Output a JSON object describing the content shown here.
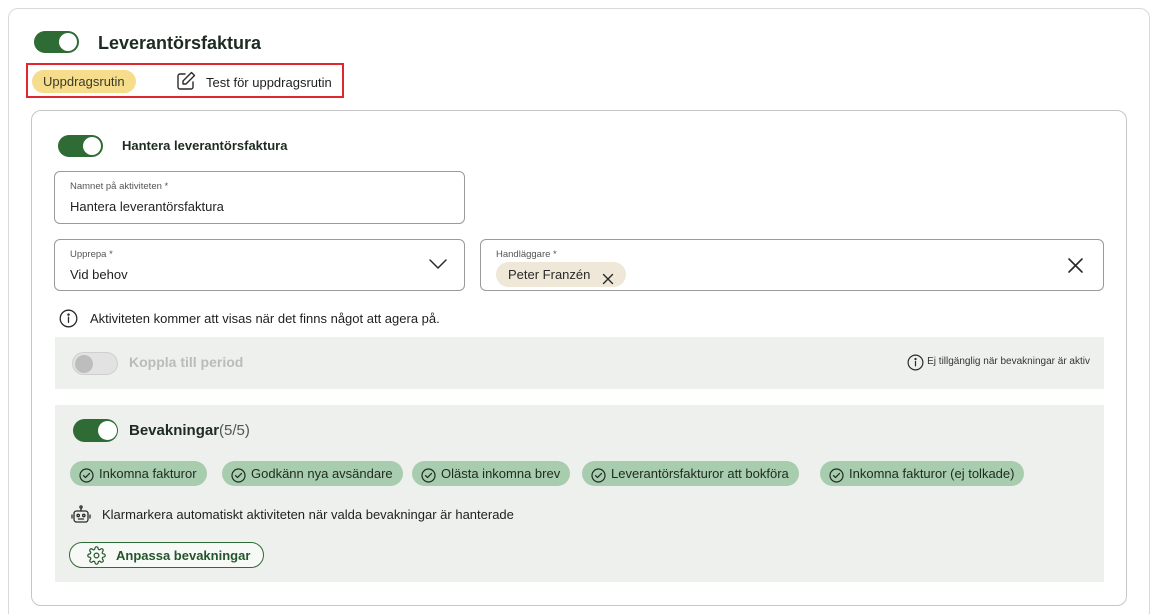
{
  "header": {
    "title": "Leverantörsfaktura",
    "enabled": true
  },
  "routine": {
    "badge": "Uppdragsrutin",
    "link": "Test för uppdragsrutin"
  },
  "activity": {
    "toggle_label": "Hantera leverantörsfaktura",
    "enabled": true,
    "name_field": {
      "label": "Namnet på aktiviteten *",
      "value": "Hantera leverantörsfaktura"
    },
    "repeat_field": {
      "label": "Upprepa *",
      "value": "Vid behov"
    },
    "handler_field": {
      "label": "Handläggare *",
      "chip": "Peter Franzén"
    },
    "info": "Aktiviteten kommer att visas när det finns något att agera på."
  },
  "period": {
    "label": "Koppla till period",
    "enabled": false,
    "note": "Ej tillgänglig när bevakningar är aktiv"
  },
  "watches": {
    "title": "Bevakningar",
    "count": "(5/5)",
    "enabled": true,
    "chips": [
      "Inkomna fakturor",
      "Godkänn nya avsändare",
      "Olästa inkomna brev",
      "Leverantörsfakturor att bokföra",
      "Inkomna fakturor (ej tolkade)"
    ],
    "auto_text": "Klarmarkera automatiskt aktiviteten när valda bevakningar är hanterade",
    "customize_button": "Anpassa bevakningar"
  },
  "colors": {
    "accent": "#2e6b35",
    "routine_badge": "#f6dd8c",
    "watch_chip": "#a8ccae",
    "panel_bg": "#eef0ee",
    "highlight_border": "#e0262f"
  }
}
